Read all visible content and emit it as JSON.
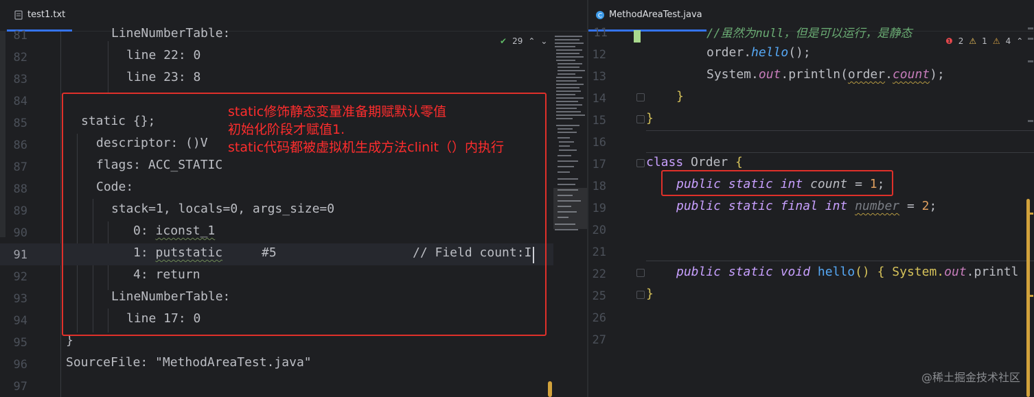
{
  "left": {
    "tab_label": "test1.txt",
    "check_count": "29",
    "lines": [
      {
        "n": "81",
        "text": "LineNumberTable:"
      },
      {
        "n": "82",
        "text": "line 22: 0"
      },
      {
        "n": "83",
        "text": "line 23: 8"
      },
      {
        "n": "84",
        "text": ""
      },
      {
        "n": "85",
        "text": "static {};"
      },
      {
        "n": "86",
        "text": "descriptor: ()V"
      },
      {
        "n": "87",
        "text": "flags: ACC_STATIC"
      },
      {
        "n": "88",
        "text": "Code:"
      },
      {
        "n": "89",
        "text": "stack=1, locals=0, args_size=0"
      },
      {
        "n": "90",
        "text_a": "0: ",
        "text_b": "iconst_1"
      },
      {
        "n": "91",
        "text_a": "1: ",
        "text_b": "putstatic",
        "text_c": "#5",
        "text_d": "// Field count:I"
      },
      {
        "n": "92",
        "text": "4: return"
      },
      {
        "n": "93",
        "text": "LineNumberTable:"
      },
      {
        "n": "94",
        "text": "line 17: 0"
      },
      {
        "n": "95",
        "text": "}"
      },
      {
        "n": "96",
        "text": "SourceFile: \"MethodAreaTest.java\""
      },
      {
        "n": "97",
        "text": ""
      }
    ],
    "annotation": "static修饰静态变量准备期赋默认零值\n初始化阶段才赋值1.\nstatic代码都被虚拟机生成方法clinit（）内执行"
  },
  "right": {
    "tab_label": "MethodAreaTest.java",
    "indicators": {
      "errors": "2",
      "warnings": "1",
      "weak": "4"
    },
    "lines": {
      "l11": "11",
      "l11_comment": "//虽然为null，但是可以运行，是静态",
      "l12": "12",
      "l12_a": "order",
      "l12_b": ".",
      "l12_c": "hello",
      "l12_d": "();",
      "l13": "13",
      "l13_a": "System.",
      "l13_b": "out",
      "l13_c": ".println(",
      "l13_d": "order",
      "l13_e": ".",
      "l13_f": "count",
      "l13_g": ");",
      "l14": "14",
      "l14_text": "}",
      "l15": "15",
      "l15_text": "}",
      "l16": "16",
      "l17": "17",
      "l17_a": "class ",
      "l17_b": "Order",
      "l17_c": " {",
      "l18": "18",
      "l18_a": "public static int ",
      "l18_b": "count",
      "l18_c": " = ",
      "l18_d": "1",
      "l18_e": ";",
      "l19": "19",
      "l19_a": "public static final int ",
      "l19_b": "number",
      "l19_c": " = ",
      "l19_d": "2",
      "l19_e": ";",
      "l20": "20",
      "l21": "21",
      "l22": "22",
      "l22_a": "public static void ",
      "l22_b": "hello",
      "l22_c": "() { System.",
      "l22_d": "out",
      "l22_e": ".printl",
      "l25": "25",
      "l25_text": "}",
      "l26": "26",
      "l27": "27"
    }
  },
  "watermark": "@稀土掘金技术社区",
  "colors": {
    "annotation_red": "#e0302a",
    "background": "#1e1f22",
    "accent_tab": "#3574f0"
  }
}
